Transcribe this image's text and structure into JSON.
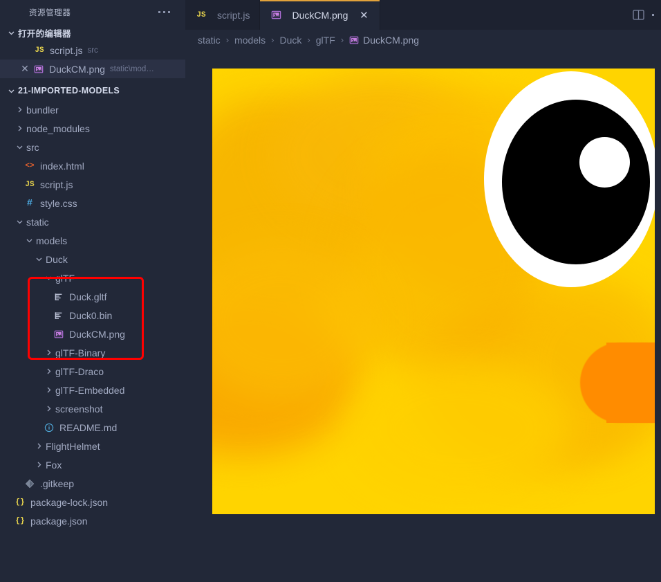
{
  "sidebar": {
    "title": "资源管理器",
    "more_icon": "ellipsis-icon",
    "open_editors": {
      "label": "打开的编辑器",
      "items": [
        {
          "name": "script.js",
          "detail": "src",
          "icon": "js-file-icon",
          "selected": false,
          "has_close": false
        },
        {
          "name": "DuckCM.png",
          "detail": "static\\mod…",
          "icon": "image-file-icon",
          "selected": true,
          "has_close": true
        }
      ]
    },
    "project": {
      "label": "21-IMPORTED-MODELS",
      "tree": [
        {
          "label": "bundler",
          "indent": 1,
          "kind": "folder",
          "expanded": false
        },
        {
          "label": "node_modules",
          "indent": 1,
          "kind": "folder",
          "expanded": false
        },
        {
          "label": "src",
          "indent": 1,
          "kind": "folder",
          "expanded": true
        },
        {
          "label": "index.html",
          "indent": 2,
          "kind": "html",
          "icon_text": "<>"
        },
        {
          "label": "script.js",
          "indent": 2,
          "kind": "js",
          "icon_text": "JS"
        },
        {
          "label": "style.css",
          "indent": 2,
          "kind": "css",
          "icon_text": "#"
        },
        {
          "label": "static",
          "indent": 1,
          "kind": "folder",
          "expanded": true
        },
        {
          "label": "models",
          "indent": 2,
          "kind": "folder",
          "expanded": true
        },
        {
          "label": "Duck",
          "indent": 3,
          "kind": "folder",
          "expanded": true
        },
        {
          "label": "glTF",
          "indent": 4,
          "kind": "folder",
          "expanded": true,
          "highlighted": true
        },
        {
          "label": "Duck.gltf",
          "indent": 5,
          "kind": "gltf",
          "highlighted": true
        },
        {
          "label": "Duck0.bin",
          "indent": 5,
          "kind": "gltf",
          "highlighted": true
        },
        {
          "label": "DuckCM.png",
          "indent": 5,
          "kind": "image",
          "highlighted": true
        },
        {
          "label": "glTF-Binary",
          "indent": 4,
          "kind": "folder",
          "expanded": false
        },
        {
          "label": "glTF-Draco",
          "indent": 4,
          "kind": "folder",
          "expanded": false
        },
        {
          "label": "glTF-Embedded",
          "indent": 4,
          "kind": "folder",
          "expanded": false
        },
        {
          "label": "screenshot",
          "indent": 4,
          "kind": "folder",
          "expanded": false
        },
        {
          "label": "README.md",
          "indent": 4,
          "kind": "md",
          "icon_text": "i"
        },
        {
          "label": "FlightHelmet",
          "indent": 3,
          "kind": "folder",
          "expanded": false
        },
        {
          "label": "Fox",
          "indent": 3,
          "kind": "folder",
          "expanded": false
        },
        {
          "label": ".gitkeep",
          "indent": 2,
          "kind": "git"
        },
        {
          "label": "package-lock.json",
          "indent": 1,
          "kind": "json",
          "icon_text": "{}"
        },
        {
          "label": "package.json",
          "indent": 1,
          "kind": "json",
          "icon_text": "{}"
        }
      ]
    }
  },
  "tabs": [
    {
      "label": "script.js",
      "icon": "js-file-icon",
      "active": false,
      "closable": false
    },
    {
      "label": "DuckCM.png",
      "icon": "image-file-icon",
      "active": true,
      "closable": true,
      "close_glyph": "✕"
    }
  ],
  "tabbar_actions": {
    "split_editor_icon": "split-editor-icon",
    "more_actions_icon": "ellipsis-icon"
  },
  "breadcrumb": {
    "separator": "›",
    "items": [
      "static",
      "models",
      "Duck",
      "glTF",
      "DuckCM.png"
    ],
    "last_icon": "image-file-icon"
  },
  "preview": {
    "file_name": "DuckCM.png",
    "description": "Duck texture map — yellow body with white-and-black eye and orange beak",
    "colors": {
      "base_yellow": "#ffd400",
      "shadow_orange": "#ffb300",
      "beak_orange": "#ff8c00",
      "eye_white": "#ffffff",
      "pupil_black": "#000000"
    }
  },
  "annotation": {
    "type": "red-rectangle-highlight",
    "color": "#ff0000",
    "targets": [
      "glTF",
      "Duck.gltf",
      "Duck0.bin",
      "DuckCM.png"
    ]
  },
  "theme": {
    "background": "#222838",
    "sidebar_background": "#222838",
    "tabbar_background": "#1d2230",
    "active_tab_background": "#222838",
    "active_tab_border": "#e2a23b",
    "selection": "#2b3145",
    "text": "#a9b1c6"
  }
}
